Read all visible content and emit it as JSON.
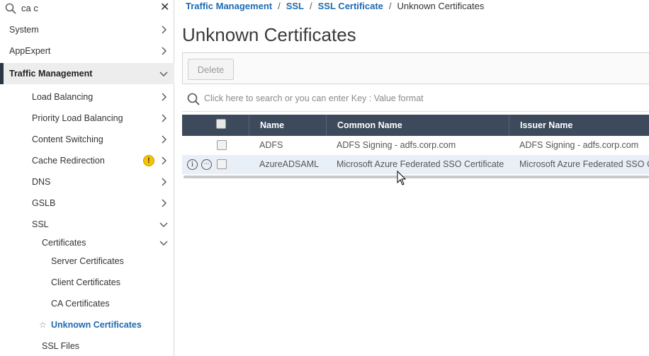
{
  "sidebar": {
    "search_value": "ca c",
    "items": [
      {
        "label": "System"
      },
      {
        "label": "AppExpert"
      },
      {
        "label": "Traffic Management"
      },
      {
        "label": "Load Balancing"
      },
      {
        "label": "Priority Load Balancing"
      },
      {
        "label": "Content Switching"
      },
      {
        "label": "Cache Redirection"
      },
      {
        "label": "DNS"
      },
      {
        "label": "GSLB"
      },
      {
        "label": "SSL"
      },
      {
        "label": "Certificates"
      },
      {
        "label": "Server Certificates"
      },
      {
        "label": "Client Certificates"
      },
      {
        "label": "CA Certificates"
      },
      {
        "label": "Unknown Certificates"
      },
      {
        "label": "SSL Files"
      }
    ],
    "warning_glyph": "!",
    "star_glyph": "☆"
  },
  "breadcrumb": {
    "items": [
      "Traffic Management",
      "SSL",
      "SSL Certificate"
    ],
    "current": "Unknown Certificates",
    "separator": "/"
  },
  "page": {
    "title": "Unknown Certificates"
  },
  "toolbar": {
    "delete_label": "Delete"
  },
  "search": {
    "placeholder": "Click here to search or you can enter Key : Value format"
  },
  "table": {
    "columns": [
      "Name",
      "Common Name",
      "Issuer Name"
    ],
    "rows": [
      {
        "name": "ADFS",
        "common_name": "ADFS Signing - adfs.corp.com",
        "issuer_name": "ADFS Signing - adfs.corp.com"
      },
      {
        "name": "AzureADSAML",
        "common_name": "Microsoft Azure Federated SSO Certificate",
        "issuer_name": "Microsoft Azure Federated SSO Ce"
      }
    ],
    "info_glyph": "i",
    "more_glyph": "···"
  },
  "colors": {
    "link": "#1d6bb3",
    "header_bg": "#3c4a5c",
    "active_bar": "#2a3644",
    "warning": "#f5c400",
    "row_hover": "#e9eff6"
  }
}
